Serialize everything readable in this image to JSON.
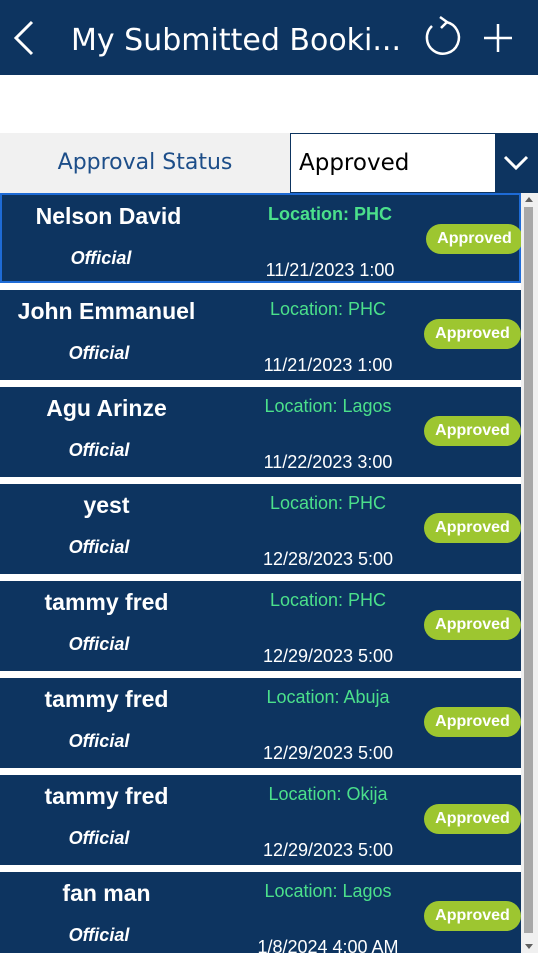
{
  "header": {
    "title": "My Submitted Booki...",
    "back_icon": "back-chevron-icon",
    "refresh_icon": "refresh-icon",
    "add_icon": "plus-icon"
  },
  "search": {
    "value": "",
    "placeholder": ""
  },
  "filter": {
    "label": "Approval Status",
    "selected": "Approved",
    "icon": "chevron-down-icon"
  },
  "colors": {
    "header_bg": "#0d3460",
    "card_bg": "#0d3460",
    "location_text": "#4be08b",
    "badge_bg": "#9dc630",
    "filter_label_text": "#1d4e89"
  },
  "bookings": [
    {
      "name": "Nelson David",
      "type": "Official",
      "location": "Location: PHC",
      "date": "11/21/2023 1:00",
      "status": "Approved"
    },
    {
      "name": "John Emmanuel",
      "type": "Official",
      "location": "Location: PHC",
      "date": "11/21/2023 1:00",
      "status": "Approved"
    },
    {
      "name": "Agu Arinze",
      "type": "Official",
      "location": "Location: Lagos",
      "date": "11/22/2023 3:00",
      "status": "Approved"
    },
    {
      "name": "yest",
      "type": "Official",
      "location": "Location: PHC",
      "date": "12/28/2023 5:00",
      "status": "Approved"
    },
    {
      "name": "tammy fred",
      "type": "Official",
      "location": "Location: PHC",
      "date": "12/29/2023 5:00",
      "status": "Approved"
    },
    {
      "name": "tammy fred",
      "type": "Official",
      "location": "Location: Abuja",
      "date": "12/29/2023 5:00",
      "status": "Approved"
    },
    {
      "name": "tammy fred",
      "type": "Official",
      "location": "Location: Okija",
      "date": "12/29/2023 5:00",
      "status": "Approved"
    },
    {
      "name": "fan man",
      "type": "Official",
      "location": "Location: Lagos",
      "date": "1/8/2024 4:00 AM",
      "status": "Approved"
    }
  ]
}
